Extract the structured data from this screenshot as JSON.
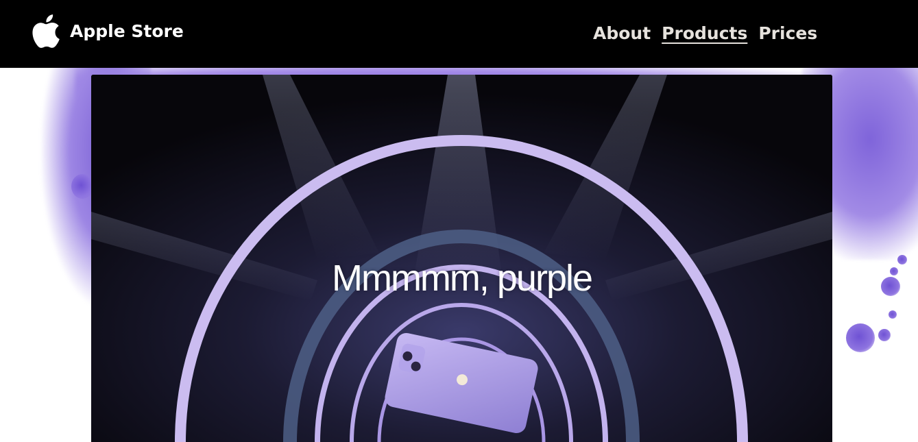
{
  "brand": {
    "name": "Apple Store",
    "logo_icon": "apple-logo-icon"
  },
  "nav": {
    "links": [
      {
        "label": "About",
        "active": false
      },
      {
        "label": "Products",
        "active": true
      },
      {
        "label": "Prices",
        "active": false
      }
    ]
  },
  "hero": {
    "caption": "Mmmmm, purple",
    "image_description_icon": "iphone-purple-stage-image"
  },
  "colors": {
    "navbar_bg": "#000000",
    "nav_text": "#e6e2dd",
    "accent_purple": "#8a6fe0",
    "hero_bg": "#0b0a12"
  }
}
